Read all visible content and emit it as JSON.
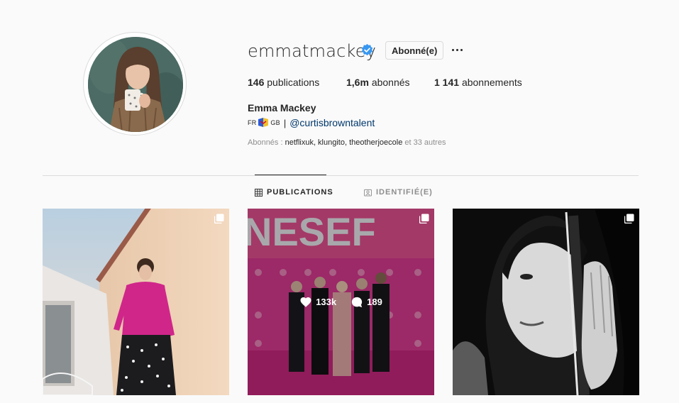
{
  "profile": {
    "username": "emmatmackey",
    "follow_label": "Abonné(e)",
    "full_name": "Emma Mackey",
    "bio_prefix": "FR",
    "bio_suffix": "GB",
    "bio_separator": "|",
    "bio_link": "@curtisbrowntalent"
  },
  "stats": {
    "posts_count": "146",
    "posts_label": "publications",
    "followers_count": "1,6m",
    "followers_label": "abonnés",
    "following_count": "1 141",
    "following_label": "abonnements"
  },
  "followed_by": {
    "prefix": "Abonnés : ",
    "names": "netflixuk, klungito, theotherjoecole",
    "suffix": " et 33 autres"
  },
  "tabs": [
    {
      "label": "PUBLICATIONS",
      "active": true
    },
    {
      "label": "IDENTIFIÉ(E)",
      "active": false
    }
  ],
  "posts": [
    {
      "multi": true
    },
    {
      "multi": true,
      "likes": "133k",
      "comments": "189"
    },
    {
      "multi": true
    }
  ],
  "colors": {
    "verified": "#3897f0",
    "link": "#00376b",
    "muted": "#8e8e8e",
    "border": "#dbdbdb"
  },
  "icons": {
    "verified": "verified-badge-icon",
    "more": "more-options-icon",
    "grid": "grid-icon",
    "tagged": "tagged-icon",
    "multi": "multiple-images-icon",
    "heart": "heart-icon",
    "comment": "comment-icon"
  }
}
